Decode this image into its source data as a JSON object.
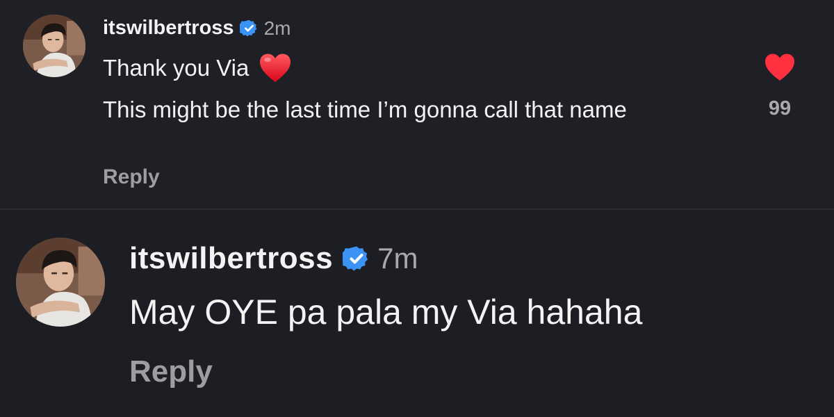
{
  "colors": {
    "background": "#1e1f24",
    "text": "#f3f3f3",
    "muted": "#a8a9ae",
    "verified": "#3b93f5",
    "like": "#ff3040"
  },
  "comments": [
    {
      "username": "itswilbertross",
      "verified_icon": "verified-badge-icon",
      "time": "2m",
      "line1": "Thank you Via",
      "line1_emoji": "red-heart-emoji",
      "line2": "This might be the last time I’m gonna call that name",
      "reply_label": "Reply",
      "like_icon": "heart-filled-icon",
      "like_count": "99"
    },
    {
      "username": "itswilbertross",
      "verified_icon": "verified-badge-icon",
      "time": "7m",
      "text": "May OYE pa pala my Via hahaha",
      "reply_label": "Reply"
    }
  ]
}
